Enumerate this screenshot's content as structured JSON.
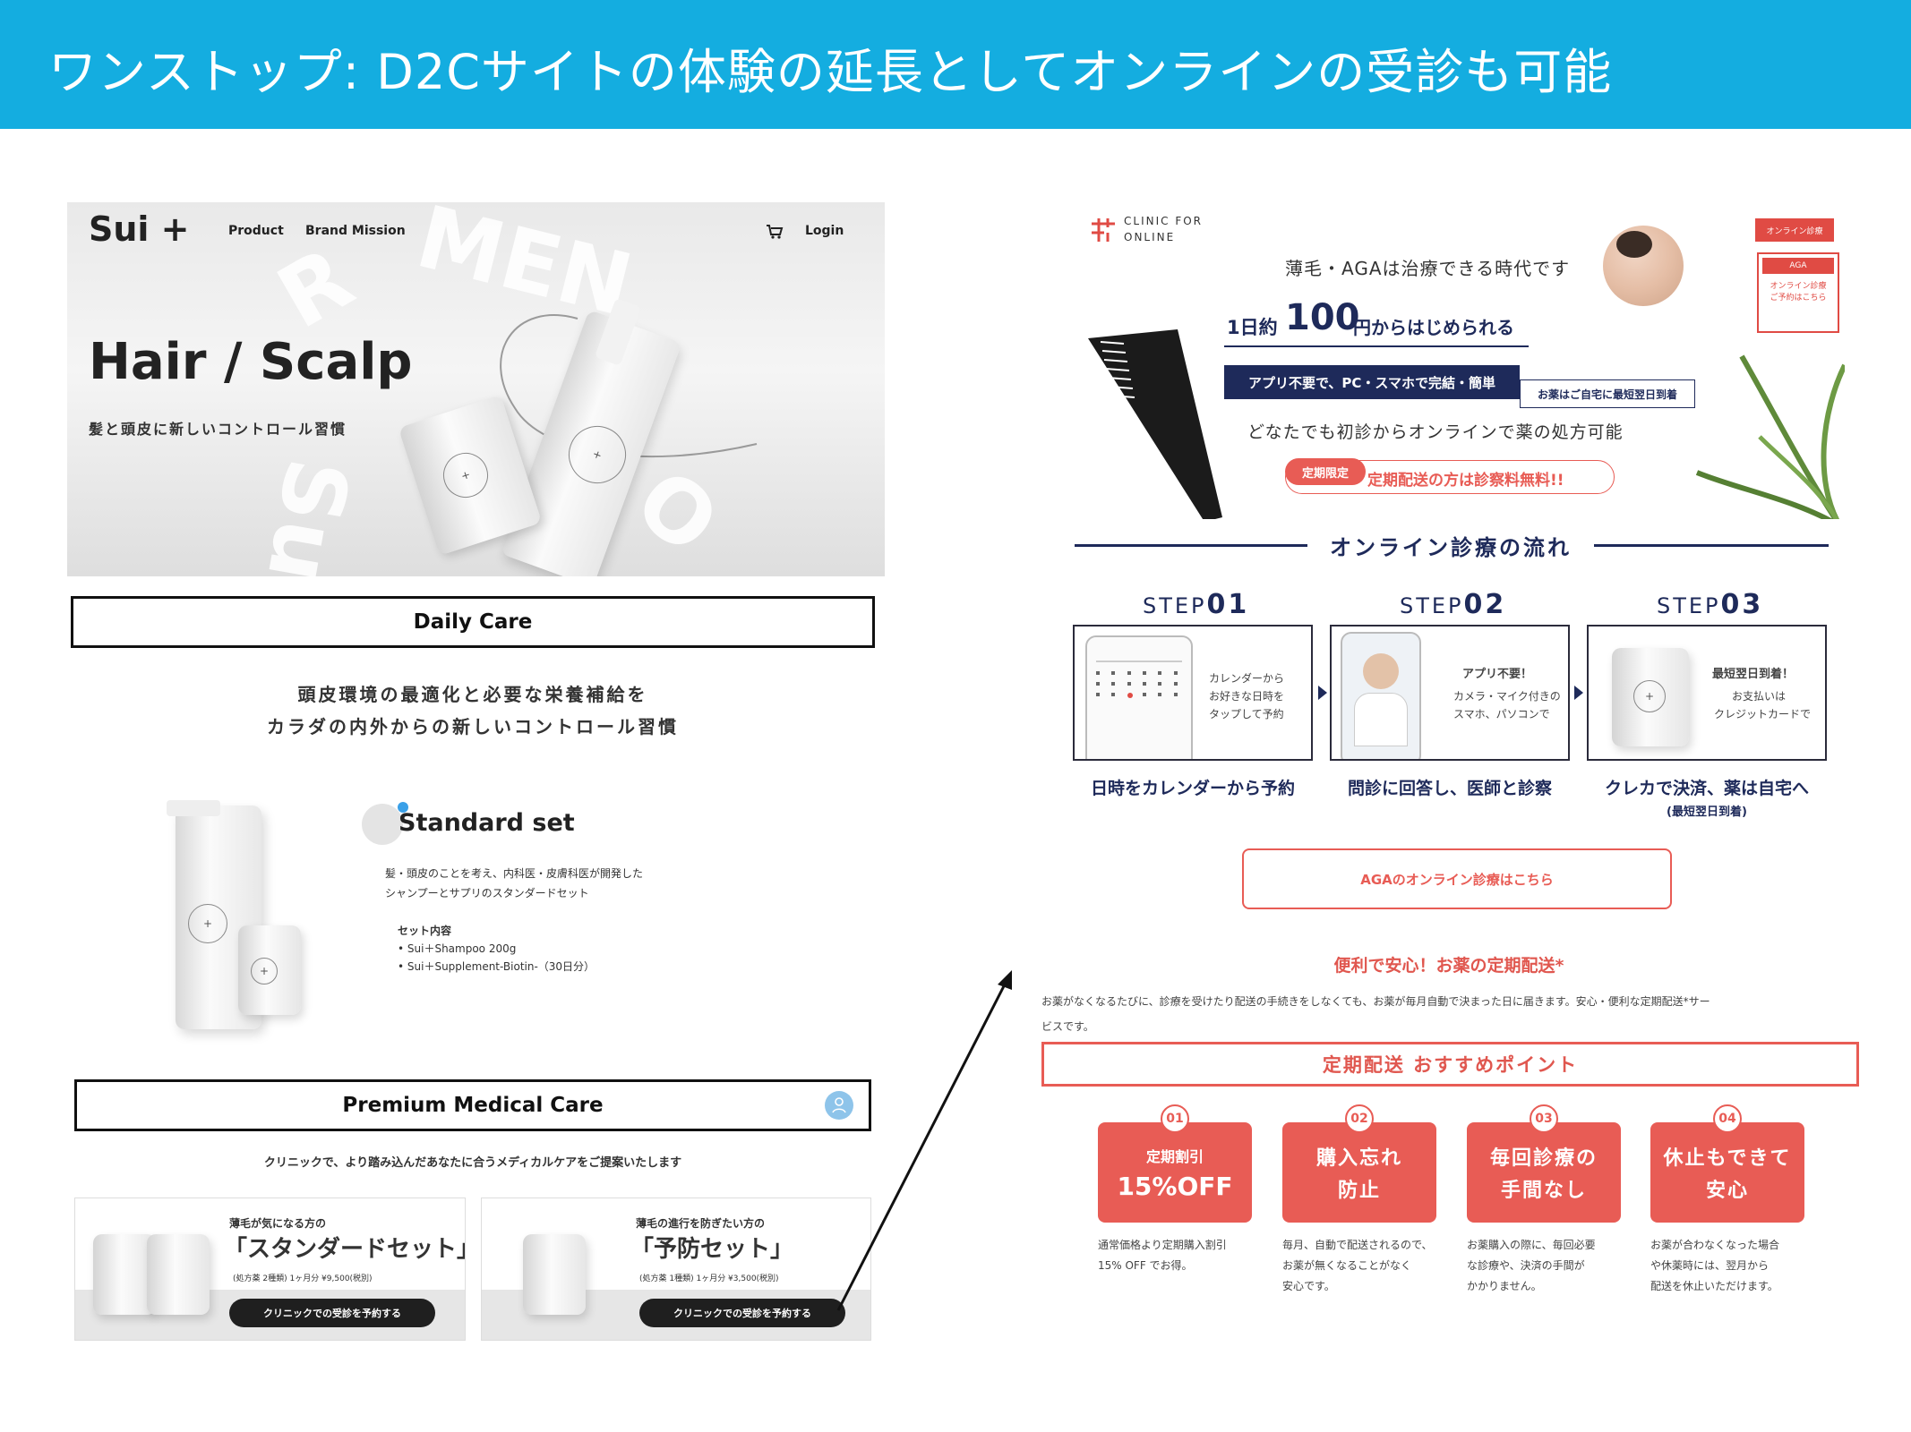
{
  "banner": {
    "title": "ワンストップ: D2Cサイトの体験の延長としてオンラインの受診も可能"
  },
  "site": {
    "logo": "Sui +",
    "nav": {
      "product": "Product",
      "brand_mission": "Brand Mission",
      "login": "Login"
    },
    "hero": {
      "title": "Hair / Scalp",
      "subtitle": "髪と頭皮に新しいコントロール習慣"
    },
    "daily_care": {
      "label": "Daily Care",
      "headline_1": "頭皮環境の最適化と必要な栄養補給を",
      "headline_2": "カラダの内外からの新しいコントロール習慣"
    },
    "standard_set": {
      "title": "Standard set",
      "desc_1": "髪・頭皮のことを考え、内科医・皮膚科医が開発した",
      "desc_2": "シャンプーとサプリのスタンダードセット",
      "contents_label": "セット内容",
      "item_1": "• Sui＋Shampoo 200g",
      "item_2": "• Sui＋Supplement-Biotin-（30日分）"
    },
    "premium": {
      "label": "Premium Medical Care",
      "desc": "クリニックで、より踏み込んだあなたに合うメディカルケアをご提案いたします",
      "cards": [
        {
          "lead": "薄毛が気になる方の",
          "name": "「スタンダードセット」",
          "detail": "(処方薬 2種類) 1ヶ月分 ¥9,500(税別)",
          "button": "クリニックでの受診を予約する"
        },
        {
          "lead": "薄毛の進行を防ぎたい方の",
          "name": "「予防セット」",
          "detail": "(処方薬 1種類) 1ヶ月分 ¥3,500(税別)",
          "button": "クリニックでの受診を予約する"
        }
      ]
    }
  },
  "clinic": {
    "logo_line1": "CLINIC FOR",
    "logo_line2": "ONLINE",
    "header_btn": "オンライン診療",
    "side_box": {
      "tag": "AGA",
      "line1": "オンライン診療",
      "line2": "ご予約はこちら"
    },
    "tagline": "薄毛・AGAは治療できる時代です",
    "price_prefix": "1日約",
    "price_value": "100",
    "price_suffix": "円からはじめられる",
    "badge_app": "アプリ不要で、PC・スマホで完結・簡単",
    "badge_delivery": "お薬はご自宅に最短翌日到着",
    "first_visit": "どなたでも初診からオンラインで薬の処方可能",
    "limited_tag": "定期限定",
    "limited_text": "定期配送の方は診察料無料!!",
    "flow_title": "オンライン診療の流れ",
    "steps": [
      {
        "label_prefix": "STEP",
        "label_num": "01",
        "text_1": "カレンダーから",
        "text_2": "お好きな日時を",
        "text_3": "タップして予約",
        "caption": "日時をカレンダーから予約",
        "note": ""
      },
      {
        "label_prefix": "STEP",
        "label_num": "02",
        "text_1": "アプリ不要！",
        "text_2": "カメラ・マイク付きの",
        "text_3": "スマホ、パソコンで",
        "caption": "問診に回答し、医師と診察",
        "note": ""
      },
      {
        "label_prefix": "STEP",
        "label_num": "03",
        "text_1": "最短翌日到着！",
        "text_2": "お支払いは",
        "text_3": "クレジットカードで",
        "caption": "クレカで決済、薬は自宅へ",
        "note": "(最短翌日到着)"
      }
    ],
    "aga_button": "AGAのオンライン診療はこちら",
    "delivery_title": "便利で安心！お薬の定期配送*",
    "delivery_desc_1": "お薬がなくなるたびに、診療を受けたり配送の手続きをしなくても、お薬が毎月自動で決まった日に届きます。安心・便利な定期配送*サー",
    "delivery_desc_2": "ビスです。",
    "points_title": "定期配送 おすすめポイント",
    "points": [
      {
        "num": "01",
        "title_1": "定期割引",
        "title_2": "15%OFF",
        "desc_1": "通常価格より定期購入割引",
        "desc_2": "15% OFF でお得。",
        "desc_3": ""
      },
      {
        "num": "02",
        "title_1": "購入忘れ",
        "title_2": "防止",
        "desc_1": "毎月、自動で配送されるので、",
        "desc_2": "お薬が無くなることがなく",
        "desc_3": "安心です。"
      },
      {
        "num": "03",
        "title_1": "毎回診療の",
        "title_2": "手間なし",
        "desc_1": "お薬購入の際に、毎回必要",
        "desc_2": "な診療や、決済の手間が",
        "desc_3": "かかりません。"
      },
      {
        "num": "04",
        "title_1": "休止もできて",
        "title_2": "安心",
        "desc_1": "お薬が合わなくなった場合",
        "desc_2": "や休薬時には、翌月から",
        "desc_3": "配送を休止いただけます。"
      }
    ]
  },
  "colors": {
    "banner": "#14ade0",
    "navy": "#1e2a5a",
    "accent_red": "#e85c55"
  }
}
